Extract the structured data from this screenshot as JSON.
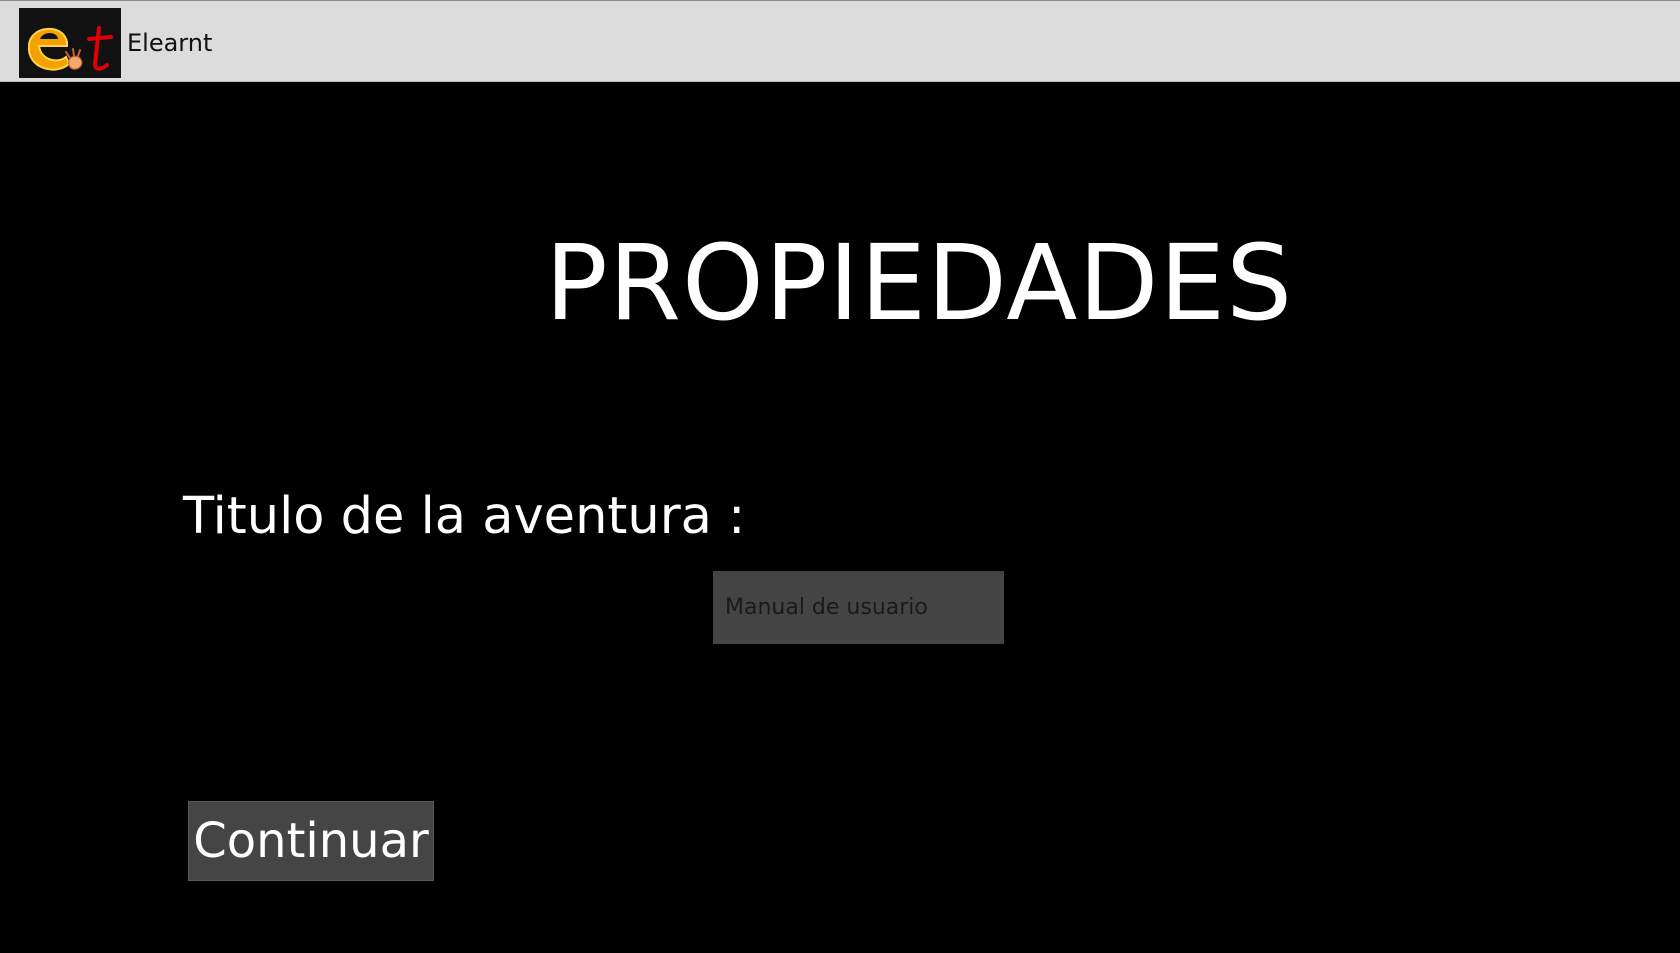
{
  "app": {
    "title": "Elearnt",
    "logo_icon": "elearnt-logo-icon"
  },
  "main": {
    "heading": "PROPIEDADES",
    "title_label": "Titulo de la aventura :",
    "title_input": {
      "value": "",
      "placeholder": "Manual de usuario"
    },
    "continue_label": "Continuar"
  },
  "colors": {
    "background": "#000000",
    "titlebar": "#dcdcdc",
    "input_background": "#444444",
    "button_background": "#454545",
    "logo_orange": "#f2a200",
    "logo_red": "#e00000"
  }
}
